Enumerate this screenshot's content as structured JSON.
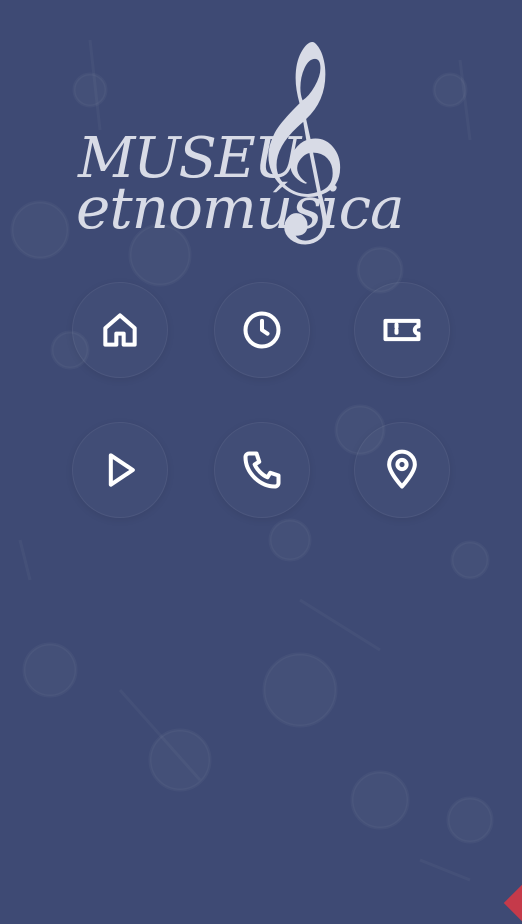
{
  "logo": {
    "line1": "MUSEU",
    "line2": "etnomúsica",
    "clef": "𝄞"
  },
  "buttons": [
    {
      "icon": "home-icon"
    },
    {
      "icon": "clock-icon"
    },
    {
      "icon": "ticket-icon"
    },
    {
      "icon": "play-icon"
    },
    {
      "icon": "phone-icon"
    },
    {
      "icon": "location-pin-icon"
    }
  ],
  "colors": {
    "background": "#3e4a74",
    "logo": "#d8dbe6",
    "icon": "#ffffff",
    "accent": "#c53a4a"
  }
}
